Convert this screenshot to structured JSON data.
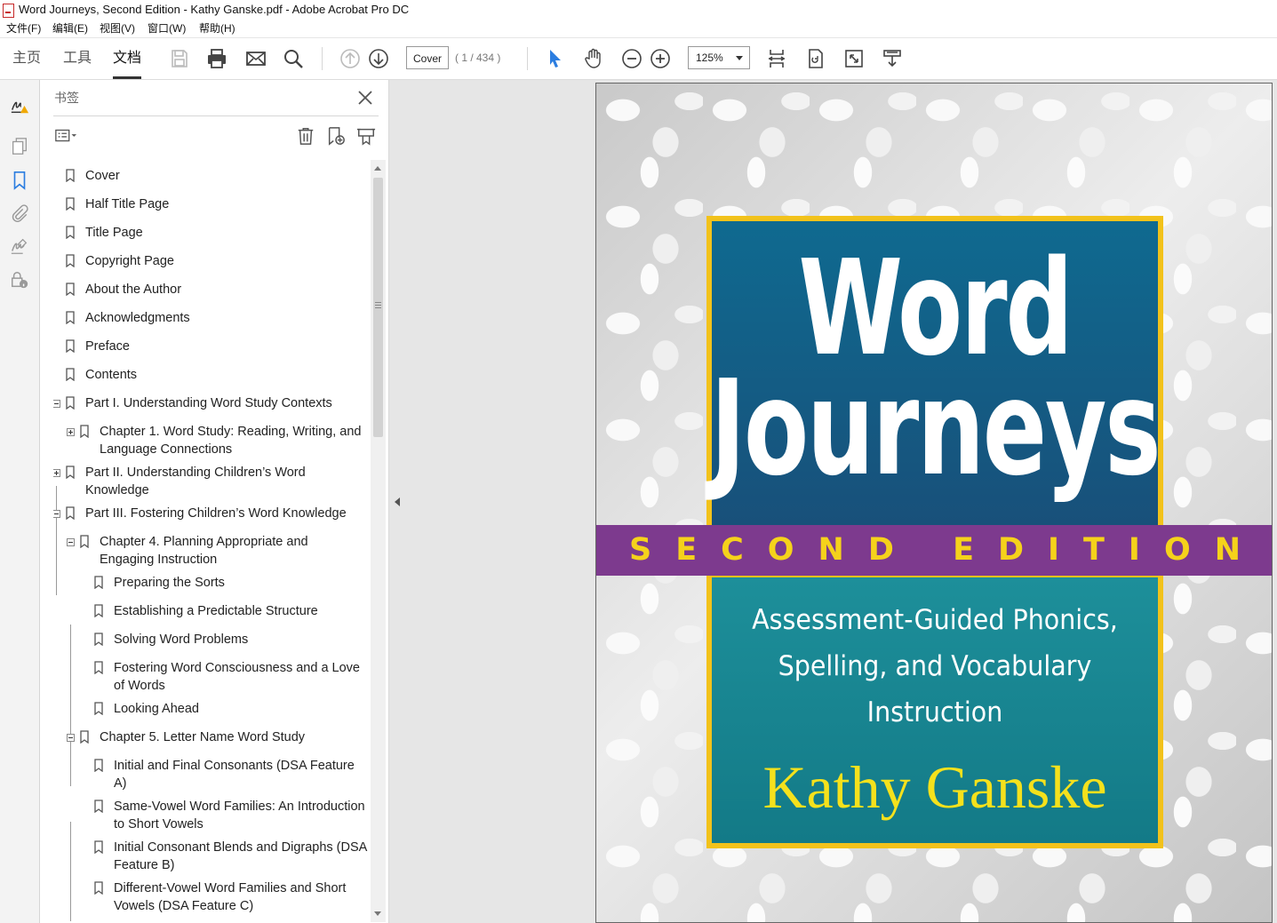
{
  "window": {
    "title": "Word Journeys, Second Edition - Kathy Ganske.pdf - Adobe Acrobat Pro DC"
  },
  "menu": [
    "文件(F)",
    "编辑(E)",
    "视图(V)",
    "窗口(W)",
    "帮助(H)"
  ],
  "tabs": [
    "主页",
    "工具",
    "文档"
  ],
  "toolbar": {
    "page_value": "Cover",
    "page_count": "( 1 / 434 )",
    "zoom": "125%"
  },
  "panel": {
    "title": "书签"
  },
  "bookmarks": [
    {
      "label": "Cover"
    },
    {
      "label": "Half Title Page"
    },
    {
      "label": "Title Page"
    },
    {
      "label": "Copyright Page"
    },
    {
      "label": "About the Author"
    },
    {
      "label": "Acknowledgments"
    },
    {
      "label": "Preface"
    },
    {
      "label": "Contents"
    },
    {
      "label": "Part I. Understanding Word Study Contexts"
    },
    {
      "label": "Chapter 1. Word Study: Reading, Writing, and Language Connections"
    },
    {
      "label": "Part II. Understanding Children’s Word Knowledge"
    },
    {
      "label": "Part III. Fostering Children’s Word Knowledge"
    },
    {
      "label": "Chapter 4. Planning Appropriate and Engaging Instruction"
    },
    {
      "label": "Preparing the Sorts"
    },
    {
      "label": "Establishing a Predictable Structure"
    },
    {
      "label": "Solving Word Problems"
    },
    {
      "label": "Fostering Word Consciousness and a Love of Words"
    },
    {
      "label": "Looking Ahead"
    },
    {
      "label": "Chapter 5. Letter Name Word Study"
    },
    {
      "label": "Initial and Final Consonants (DSA Feature A)"
    },
    {
      "label": "Same-Vowel Word Families: An Introduction to Short Vowels"
    },
    {
      "label": "Initial Consonant Blends and Digraphs (DSA Feature B)"
    },
    {
      "label": "Different-Vowel Word Families and Short Vowels (DSA Feature C)"
    }
  ],
  "cover": {
    "title_line1": "Word",
    "title_line2": "Journeys",
    "edition": "SECOND EDITION",
    "subtitle_line1": "Assessment-Guided Phonics,",
    "subtitle_line2": "Spelling, and Vocabulary",
    "subtitle_line3": "Instruction",
    "author": "Kathy Ganske"
  },
  "colors": {
    "accent": "#2b7de0",
    "cover_yellow": "#f2c21b",
    "cover_purple": "#7d3a8e",
    "cover_blue": "#0f6a90",
    "cover_teal": "#1d8f9a"
  }
}
